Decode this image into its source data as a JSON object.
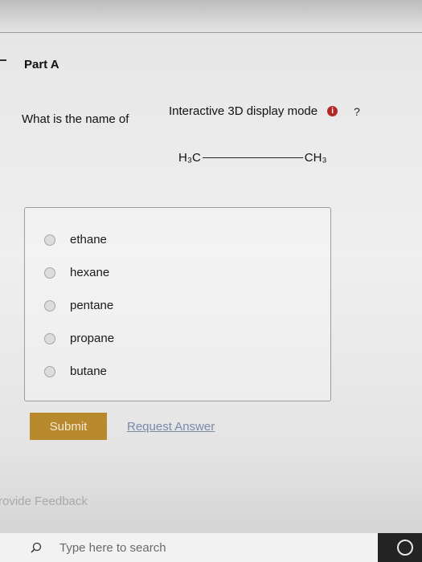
{
  "part": {
    "title": "Part A"
  },
  "question": {
    "text": "What is the name of"
  },
  "display_mode": {
    "label": "Interactive 3D display mode",
    "help": "?"
  },
  "molecule": {
    "left": "H₃C",
    "right": "CH₃"
  },
  "options": [
    {
      "label": "ethane"
    },
    {
      "label": "hexane"
    },
    {
      "label": "pentane"
    },
    {
      "label": "propane"
    },
    {
      "label": "butane"
    }
  ],
  "actions": {
    "submit_label": "Submit",
    "request_label": "Request Answer"
  },
  "feedback": {
    "label": "rovide Feedback"
  },
  "taskbar": {
    "search_placeholder": "Type here to search"
  },
  "colors": {
    "submit": "#b8892d",
    "link": "#7a89a8",
    "info": "#b32a2a"
  }
}
